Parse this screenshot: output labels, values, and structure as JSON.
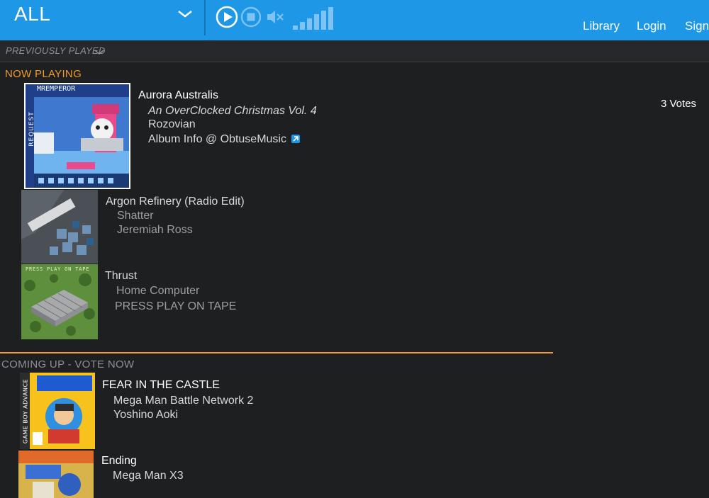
{
  "topbar": {
    "station": "ALL",
    "icons": {
      "play": "play-circle-icon",
      "stop": "stop-circle-icon",
      "mute": "speaker-muted-icon",
      "volume": "volume-bars-icon"
    },
    "nav": {
      "library": "Library",
      "login": "Login",
      "sign": "Sign"
    },
    "accent": "#1e97e6"
  },
  "previously_played": {
    "label": "PREVIOUSLY PLAYED"
  },
  "now_playing": {
    "heading": "NOW PLAYING",
    "current": {
      "title": "Aurora Australis",
      "album": "An OverClocked Christmas Vol. 4",
      "artist": "Rozovian",
      "album_info": "Album Info @ ObtuseMusic",
      "votes": "3 Votes",
      "art_text_top": "MREMPEROR",
      "art_text_side": "REQUEST"
    },
    "recent": [
      {
        "title": "Argon Refinery (Radio Edit)",
        "album": "Shatter",
        "artist": "Jeremiah Ross"
      },
      {
        "title": "Thrust",
        "album": "Home Computer",
        "artist": "PRESS PLAY ON TAPE",
        "art_text": "PRESS PLAY ON TAPE"
      }
    ]
  },
  "coming_up": {
    "heading": "COMING UP - VOTE NOW",
    "items": [
      {
        "title": "FEAR IN THE CASTLE",
        "album": "Mega Man Battle Network 2",
        "artist": "Yoshino Aoki",
        "art_text": "GAME BOY ADVANCE"
      },
      {
        "title": "Ending",
        "album": "Mega Man X3",
        "artist": ""
      }
    ]
  },
  "colors": {
    "orange": "#f29a2e",
    "background": "#1e1f21"
  }
}
